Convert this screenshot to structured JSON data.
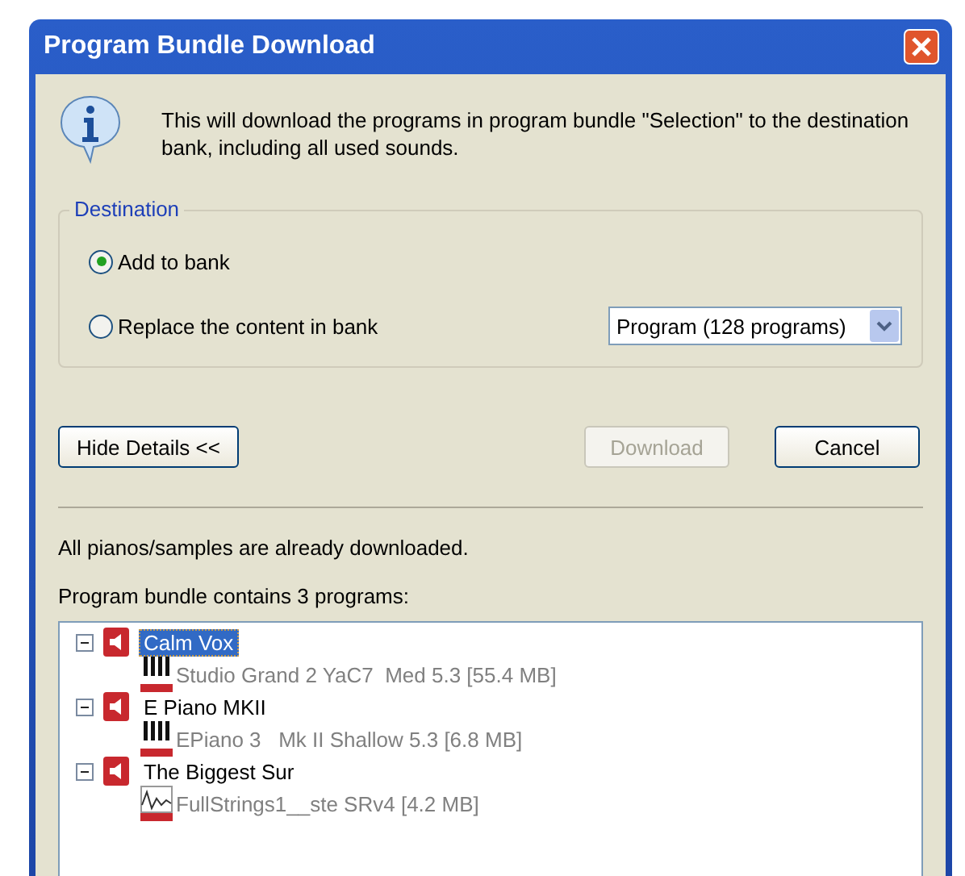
{
  "window": {
    "title": "Program Bundle Download"
  },
  "message": "This will download the programs in program bundle \"Selection\" to the destination bank, including all used sounds.",
  "destination": {
    "legend": "Destination",
    "options": [
      {
        "label": "Add to bank",
        "selected": true
      },
      {
        "label": "Replace the content in bank",
        "selected": false
      }
    ],
    "bank_select": {
      "value": "Program (128 programs)"
    }
  },
  "buttons": [
    {
      "label": "Hide Details <<",
      "disabled": false
    },
    {
      "label": "Download",
      "disabled": true
    },
    {
      "label": "Cancel",
      "disabled": false
    }
  ],
  "status": "All pianos/samples are already downloaded.",
  "tree_caption": "Program bundle contains 3 programs:",
  "tree": [
    {
      "label": "Calm Vox",
      "selected": true,
      "expanded": true,
      "children": [
        {
          "label": "Studio Grand 2 YaC7  Med 5.3 [55.4 MB]",
          "kind": "piano"
        }
      ]
    },
    {
      "label": "E Piano MKII",
      "selected": false,
      "expanded": true,
      "children": [
        {
          "label": "EPiano 3   Mk II Shallow 5.3 [6.8 MB]",
          "kind": "piano"
        }
      ]
    },
    {
      "label": "The Biggest Sur",
      "selected": false,
      "expanded": true,
      "children": [
        {
          "label": "FullStrings1__ste SRv4 [4.2 MB]",
          "kind": "strings"
        }
      ]
    }
  ]
}
